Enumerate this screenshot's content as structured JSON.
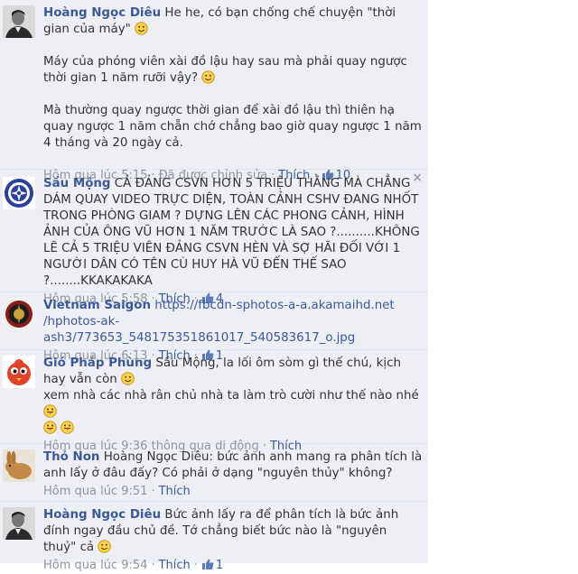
{
  "comments": [
    {
      "author": "Hoàng Ngọc Diêu",
      "p1": "He he, có bạn chống chế chuyện \"thời gian của máy\"",
      "p2": "Máy của phóng viên xài đồ lậu hay sau mà phải quay ngược thời gian 1 năm rưỡi vậy?",
      "p3": "Mà thường quay ngược thời gian để xài đồ lậu thì thiên hạ quay ngược 1 năm chẵn chớ chẳng bao giờ quay ngược 1 năm 4 tháng và 20 ngày cả.",
      "time": "Hôm qua lúc 5:15",
      "edited": "Đã được chỉnh sửa",
      "like": "Thích",
      "likes": "10"
    },
    {
      "author": "Sầu Mộng",
      "text": "CẢ ĐẢNG CSVN HƠN 5 TRIỆU THẰNG MÀ CHẲNG DÁM QUAY VIDEO TRỰC DIỆN, TOÀN CẢNH CSHV ĐANG NHỐT TRONG PHÒNG GIAM ? DỰNG LÊN CÁC PHONG CẢNH, HÌNH ẢNH CỦA ÔNG VŨ HƠN 1 NĂM TRƯỚC LÀ SAO ?..........KHÔNG LẼ CẢ 5 TRIỆU VIÊN ĐẢNG CSVN HÈN VÀ SỢ HÃI ĐỐI VỚI 1 NGƯỜI DÂN CÓ TÊN CÙ HUY HÀ VŨ ĐẾN THẾ SAO ?........KKAKAKAKA",
      "time": "Hôm qua lúc 5:58",
      "like": "Thích",
      "likes": "4",
      "close": "×"
    },
    {
      "author": "Vietnam Saigon",
      "link": "https://fbcdn-sphotos-a-a.akamaihd.net/hphotos-ak-ash3/773653_548175351861017_540583617_o.jpg",
      "link_line1": "https://fbcdn-sphotos-a-a.akamaihd.net",
      "link_line2": "/hphotos-ak-ash3/773653_548175351861017_540583617_o.jpg",
      "time": "Hôm qua lúc 6:13",
      "like": "Thích",
      "likes": "1"
    },
    {
      "author": "Gió Pháp Phùng",
      "text1": "Sầu Mộng, la lối ôm sòm gì thế chú, kịch hay vẫn còn",
      "text2": "xem nhà các nhà rân chủ nhà ta làm trò cười như thế nào nhé",
      "time": "Hôm qua lúc 9:36",
      "via": "thông qua di động",
      "like": "Thích"
    },
    {
      "author": "Thỏ Non",
      "text": "Hoàng Ngọc Diêu: bức ảnh anh mang ra phân tích là anh lấy ở đâu đấy? Có phải ở dạng \"nguyên thủy\" không?",
      "time": "Hôm qua lúc 9:51",
      "like": "Thích"
    },
    {
      "author": "Hoàng Ngọc Diêu",
      "text": "Bức ảnh lấy ra để phân tích là bức ảnh đính ngay đầu chủ đề. Tớ chẳng biết bức nào là \"nguyên thuỷ\" cả",
      "time": "Hôm qua lúc 9:54",
      "like": "Thích",
      "likes": "1"
    }
  ],
  "colors": {
    "link": "#3b5998",
    "meta": "#90949c",
    "feed_bg": "#edeff4"
  }
}
